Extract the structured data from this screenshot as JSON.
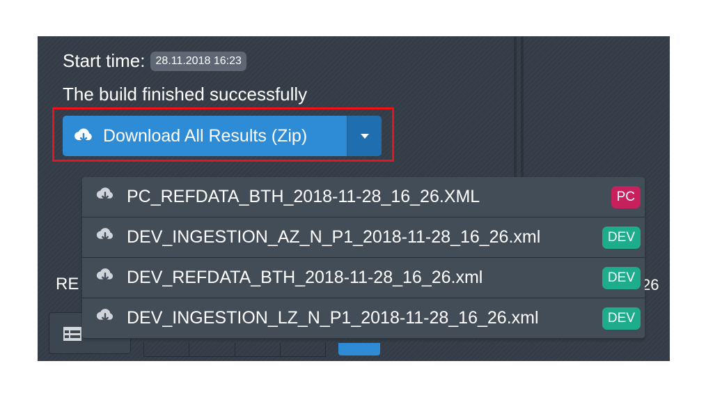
{
  "build": {
    "start_label": "Start time:",
    "start_time": "28.11.2018 16:23",
    "status": "The build finished successfully"
  },
  "download": {
    "label": "Download All Results (Zip)",
    "icon": "cloud-download-icon",
    "toggle_icon": "caret-down-icon"
  },
  "files": [
    {
      "name": "PC_REFDATA_BTH_2018-11-28_16_26.XML",
      "tag": "PC",
      "tag_color": "#c7215d"
    },
    {
      "name": "DEV_INGESTION_AZ_N_P1_2018-11-28_16_26.xml",
      "tag": "DEV",
      "tag_color": "#1dad8c"
    },
    {
      "name": "DEV_REFDATA_BTH_2018-11-28_16_26.xml",
      "tag": "DEV",
      "tag_color": "#1dad8c"
    },
    {
      "name": "DEV_INGESTION_LZ_N_P1_2018-11-28_16_26.xml",
      "tag": "DEV",
      "tag_color": "#1dad8c"
    }
  ],
  "background": {
    "label_fragment": "RE",
    "number_fragment": "26"
  },
  "colors": {
    "panel": "#343d47",
    "primary": "#2e8bd6",
    "highlight": "#e8141c"
  }
}
